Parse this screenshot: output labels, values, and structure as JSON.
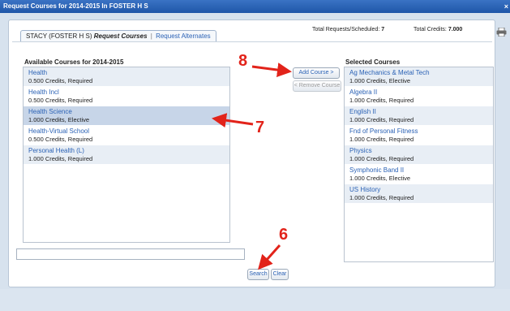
{
  "window": {
    "title": "Request Courses for 2014-2015 In FOSTER H S",
    "close_glyph": "×"
  },
  "tabs": {
    "student": "STACY (FOSTER H S)",
    "active": "Request Courses",
    "separator": "|",
    "alternates": "Request Alternates"
  },
  "totals": {
    "requests_label": "Total Requests/Scheduled:",
    "requests_value": "7",
    "credits_label": "Total Credits:",
    "credits_value": "7.000"
  },
  "available": {
    "title": "Available Courses for 2014-2015",
    "courses": [
      {
        "name": "Health",
        "meta": "0.500 Credits,  Required"
      },
      {
        "name": "Health Incl",
        "meta": "0.500 Credits,  Required"
      },
      {
        "name": "Health Science",
        "meta": "1.000 Credits,  Elective"
      },
      {
        "name": "Health-Virtual School",
        "meta": "0.500 Credits,  Required"
      },
      {
        "name": "Personal Health (L)",
        "meta": "1.000 Credits,  Required"
      }
    ]
  },
  "selected": {
    "title": "Selected Courses",
    "courses": [
      {
        "name": "Ag Mechanics & Metal Tech",
        "meta": "1.000 Credits,  Elective"
      },
      {
        "name": "Algebra II",
        "meta": "1.000 Credits,  Required"
      },
      {
        "name": "English II",
        "meta": "1.000 Credits,  Required"
      },
      {
        "name": "Fnd of Personal Fitness",
        "meta": "1.000 Credits,  Required"
      },
      {
        "name": "Physics",
        "meta": "1.000 Credits,  Required"
      },
      {
        "name": "Symphonic Band II",
        "meta": "1.000 Credits,  Elective"
      },
      {
        "name": "US History",
        "meta": "1.000 Credits,  Required"
      }
    ]
  },
  "buttons": {
    "add": "Add Course >",
    "remove": "< Remove Course",
    "search": "Search",
    "clear": "Clear"
  },
  "search": {
    "value": ""
  },
  "annotations": {
    "six": "6",
    "seven": "7",
    "eight": "8"
  },
  "colors": {
    "titlebar": "#2a63b8",
    "link": "#2b62b5",
    "annotation": "#e2231a",
    "selected_row": "#c7d5e8"
  },
  "icons": {
    "printer": "printer-icon"
  }
}
